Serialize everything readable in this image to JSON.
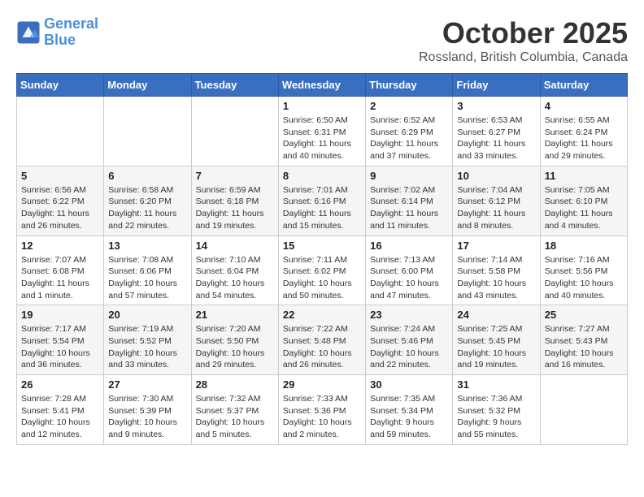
{
  "header": {
    "logo_line1": "General",
    "logo_line2": "Blue",
    "month": "October 2025",
    "location": "Rossland, British Columbia, Canada"
  },
  "days_of_week": [
    "Sunday",
    "Monday",
    "Tuesday",
    "Wednesday",
    "Thursday",
    "Friday",
    "Saturday"
  ],
  "weeks": [
    [
      {
        "day": "",
        "info": ""
      },
      {
        "day": "",
        "info": ""
      },
      {
        "day": "",
        "info": ""
      },
      {
        "day": "1",
        "info": "Sunrise: 6:50 AM\nSunset: 6:31 PM\nDaylight: 11 hours\nand 40 minutes."
      },
      {
        "day": "2",
        "info": "Sunrise: 6:52 AM\nSunset: 6:29 PM\nDaylight: 11 hours\nand 37 minutes."
      },
      {
        "day": "3",
        "info": "Sunrise: 6:53 AM\nSunset: 6:27 PM\nDaylight: 11 hours\nand 33 minutes."
      },
      {
        "day": "4",
        "info": "Sunrise: 6:55 AM\nSunset: 6:24 PM\nDaylight: 11 hours\nand 29 minutes."
      }
    ],
    [
      {
        "day": "5",
        "info": "Sunrise: 6:56 AM\nSunset: 6:22 PM\nDaylight: 11 hours\nand 26 minutes."
      },
      {
        "day": "6",
        "info": "Sunrise: 6:58 AM\nSunset: 6:20 PM\nDaylight: 11 hours\nand 22 minutes."
      },
      {
        "day": "7",
        "info": "Sunrise: 6:59 AM\nSunset: 6:18 PM\nDaylight: 11 hours\nand 19 minutes."
      },
      {
        "day": "8",
        "info": "Sunrise: 7:01 AM\nSunset: 6:16 PM\nDaylight: 11 hours\nand 15 minutes."
      },
      {
        "day": "9",
        "info": "Sunrise: 7:02 AM\nSunset: 6:14 PM\nDaylight: 11 hours\nand 11 minutes."
      },
      {
        "day": "10",
        "info": "Sunrise: 7:04 AM\nSunset: 6:12 PM\nDaylight: 11 hours\nand 8 minutes."
      },
      {
        "day": "11",
        "info": "Sunrise: 7:05 AM\nSunset: 6:10 PM\nDaylight: 11 hours\nand 4 minutes."
      }
    ],
    [
      {
        "day": "12",
        "info": "Sunrise: 7:07 AM\nSunset: 6:08 PM\nDaylight: 11 hours\nand 1 minute."
      },
      {
        "day": "13",
        "info": "Sunrise: 7:08 AM\nSunset: 6:06 PM\nDaylight: 10 hours\nand 57 minutes."
      },
      {
        "day": "14",
        "info": "Sunrise: 7:10 AM\nSunset: 6:04 PM\nDaylight: 10 hours\nand 54 minutes."
      },
      {
        "day": "15",
        "info": "Sunrise: 7:11 AM\nSunset: 6:02 PM\nDaylight: 10 hours\nand 50 minutes."
      },
      {
        "day": "16",
        "info": "Sunrise: 7:13 AM\nSunset: 6:00 PM\nDaylight: 10 hours\nand 47 minutes."
      },
      {
        "day": "17",
        "info": "Sunrise: 7:14 AM\nSunset: 5:58 PM\nDaylight: 10 hours\nand 43 minutes."
      },
      {
        "day": "18",
        "info": "Sunrise: 7:16 AM\nSunset: 5:56 PM\nDaylight: 10 hours\nand 40 minutes."
      }
    ],
    [
      {
        "day": "19",
        "info": "Sunrise: 7:17 AM\nSunset: 5:54 PM\nDaylight: 10 hours\nand 36 minutes."
      },
      {
        "day": "20",
        "info": "Sunrise: 7:19 AM\nSunset: 5:52 PM\nDaylight: 10 hours\nand 33 minutes."
      },
      {
        "day": "21",
        "info": "Sunrise: 7:20 AM\nSunset: 5:50 PM\nDaylight: 10 hours\nand 29 minutes."
      },
      {
        "day": "22",
        "info": "Sunrise: 7:22 AM\nSunset: 5:48 PM\nDaylight: 10 hours\nand 26 minutes."
      },
      {
        "day": "23",
        "info": "Sunrise: 7:24 AM\nSunset: 5:46 PM\nDaylight: 10 hours\nand 22 minutes."
      },
      {
        "day": "24",
        "info": "Sunrise: 7:25 AM\nSunset: 5:45 PM\nDaylight: 10 hours\nand 19 minutes."
      },
      {
        "day": "25",
        "info": "Sunrise: 7:27 AM\nSunset: 5:43 PM\nDaylight: 10 hours\nand 16 minutes."
      }
    ],
    [
      {
        "day": "26",
        "info": "Sunrise: 7:28 AM\nSunset: 5:41 PM\nDaylight: 10 hours\nand 12 minutes."
      },
      {
        "day": "27",
        "info": "Sunrise: 7:30 AM\nSunset: 5:39 PM\nDaylight: 10 hours\nand 9 minutes."
      },
      {
        "day": "28",
        "info": "Sunrise: 7:32 AM\nSunset: 5:37 PM\nDaylight: 10 hours\nand 5 minutes."
      },
      {
        "day": "29",
        "info": "Sunrise: 7:33 AM\nSunset: 5:36 PM\nDaylight: 10 hours\nand 2 minutes."
      },
      {
        "day": "30",
        "info": "Sunrise: 7:35 AM\nSunset: 5:34 PM\nDaylight: 9 hours\nand 59 minutes."
      },
      {
        "day": "31",
        "info": "Sunrise: 7:36 AM\nSunset: 5:32 PM\nDaylight: 9 hours\nand 55 minutes."
      },
      {
        "day": "",
        "info": ""
      }
    ]
  ]
}
